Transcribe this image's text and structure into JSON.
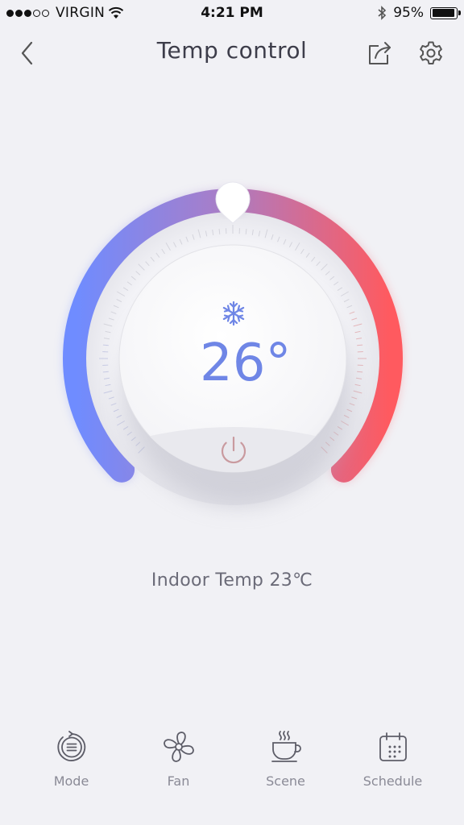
{
  "status": {
    "carrier": "VIRGIN",
    "time": "4:21 PM",
    "battery": "95%",
    "battery_level": 0.95
  },
  "nav": {
    "title": "Temp control"
  },
  "thermostat": {
    "set_temp": "26°",
    "mode_icon": "snowflake-icon",
    "level": 0.5
  },
  "indoor": {
    "label": "Indoor Temp 23℃"
  },
  "tabs": [
    {
      "label": "Mode",
      "icon": "mode-icon"
    },
    {
      "label": "Fan",
      "icon": "fan-icon"
    },
    {
      "label": "Scene",
      "icon": "coffee-icon"
    },
    {
      "label": "Schedule",
      "icon": "calendar-icon"
    }
  ],
  "colors": {
    "cool": "#6f8cff",
    "mid": "#a77ec9",
    "warm": "#ff5a5f",
    "background": "#f1f1f5",
    "temp_text": "#6f86e6"
  }
}
